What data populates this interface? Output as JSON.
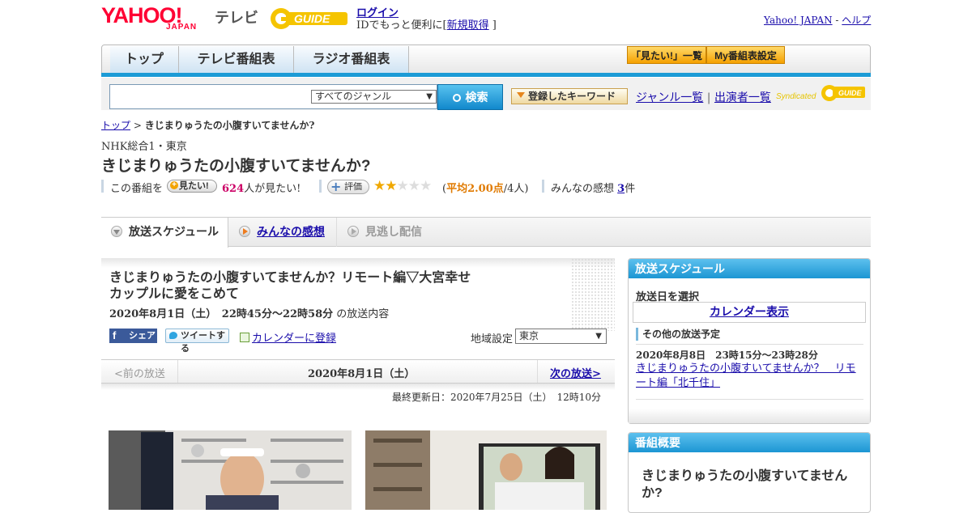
{
  "header": {
    "yahoo_logo": "YAHOO!",
    "japan_logo": "JAPAN",
    "tv_label": "テレビ",
    "gguide_logo": "GUIDE",
    "login_label": "ログイン",
    "id_text_prefix": "IDでもっと便利に[",
    "register_label": "新規取得",
    "id_text_suffix": "]",
    "yahoo_japan_link": "Yahoo! JAPAN",
    "separator": "-",
    "help_link": "ヘルプ"
  },
  "nav": {
    "tabs": [
      {
        "label": "トップ"
      },
      {
        "label": "テレビ番組表"
      },
      {
        "label": "ラジオ番組表"
      }
    ],
    "want_list_label": "「見たい!」一覧",
    "my_schedule_label": "My番組表設定"
  },
  "search": {
    "placeholder": "",
    "genre_selected": "すべてのジャンル",
    "search_button": "検索",
    "keyword_button": "登録したキーワード",
    "genre_list": "ジャンル一覧",
    "link_separator": "|",
    "cast_list": "出演者一覧",
    "syndicated": "Syndicated",
    "syndicated_logo": "GUIDE"
  },
  "breadcrumb": {
    "top": "トップ",
    "separator": ">",
    "current": "きじまりゅうたの小腹すいてませんか?"
  },
  "program": {
    "channel": "NHK総合1・東京",
    "title": "きじまりゅうたの小腹すいてませんか?",
    "want_prefix": "この番組を",
    "want_badge": "見たい!",
    "want_count": "624",
    "want_suffix": "人が見たい!",
    "rate_badge": "評価",
    "stars_on": "★★",
    "stars_off": "★★★",
    "avg_open": "(",
    "avg_label": "平均2.00点",
    "avg_count": "/4人)",
    "comments_prefix": "みんなの感想",
    "comments_count": "3",
    "comments_suffix": "件"
  },
  "tabs": {
    "schedule": "放送スケジュール",
    "reviews": "みんなの感想",
    "vod": "見逃し配信"
  },
  "episode": {
    "title_line1": "きじまりゅうたの小腹すいてませんか？リモート編▽大宮幸せ",
    "title_line2": "カップルに愛をこめて",
    "date": "2020年8月1日（土）　22時45分～22時58分",
    "date_suffix": "の放送内容",
    "share_fb": "シェア",
    "share_tw": "ツイートする",
    "calendar_register": "カレンダーに登録",
    "region_label": "地域設定",
    "region_selected": "東京",
    "prev": "<前の放送",
    "current_date": "2020年8月1日（土）",
    "next": "次の放送>",
    "updated": "最終更新日：2020年7月25日（土）　12時10分"
  },
  "sidebar": {
    "schedule_head": "放送スケジュール",
    "select_date": "放送日を選択",
    "calendar_button": "カレンダー表示",
    "other_schedule": "その他の放送予定",
    "other_date": "2020年8月8日　23時15分～23時28分",
    "other_link": "きじまりゅうたの小腹すいてませんか？　リモート編「北千住」",
    "summary_head": "番組概要",
    "summary_title": "きじまりゅうたの小腹すいてません か?"
  },
  "colors": {
    "accent_blue": "#1c9bd6",
    "yahoo_red": "#ff0033",
    "gguide_yellow": "#f5c400",
    "want_pink": "#cc0066",
    "avg_orange": "#e07a00"
  }
}
